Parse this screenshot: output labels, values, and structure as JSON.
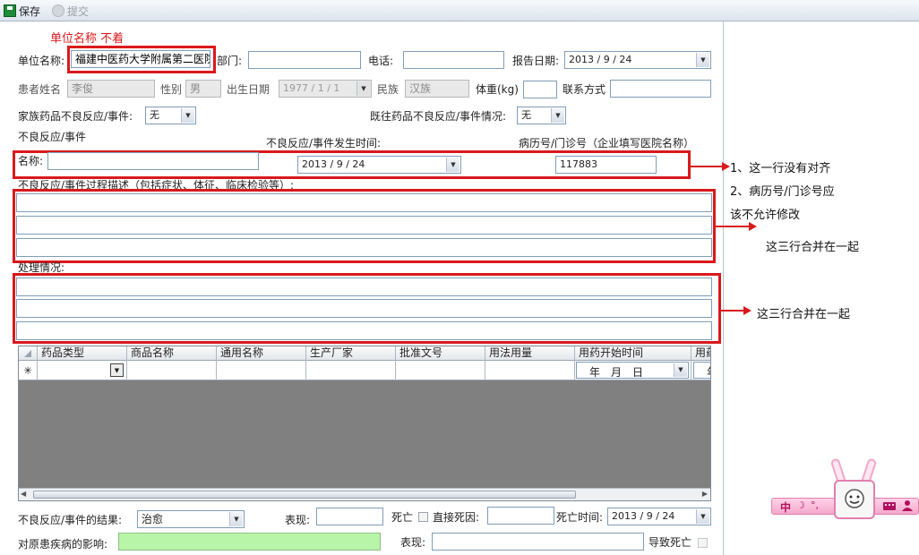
{
  "toolbar": {
    "save_label": "保存",
    "submit_label": "提交"
  },
  "annotation_top": "单位名称 不着",
  "row1": {
    "unit_label": "单位名称:",
    "unit_value": "福建中医药大学附属第二医院",
    "dept_label": "部门:",
    "dept_value": "",
    "phone_label": "电话:",
    "phone_value": "",
    "report_date_label": "报告日期:",
    "report_date_value": "2013 / 9 / 24"
  },
  "row2": {
    "patient_label": "患者姓名",
    "patient_value": "李俊",
    "gender_label": "性别",
    "gender_value": "男",
    "birth_label": "出生日期",
    "birth_value": "1977 / 1 / 1",
    "ethnic_label": "民族",
    "ethnic_value": "汉族",
    "weight_label": "体重(kg)",
    "weight_value": "",
    "contact_label": "联系方式",
    "contact_value": ""
  },
  "row3": {
    "family_label": "家族药品不良反应/事件:",
    "family_value": "无",
    "history_label": "既往药品不良反应/事件情况:",
    "history_value": "无"
  },
  "adr": {
    "section_label": "不良反应/事件",
    "time_label": "不良反应/事件发生时间:",
    "record_label": "病历号/门诊号（企业填写医院名称）",
    "name_label": "名称:",
    "name_value": "",
    "time_value": "2013 / 9 / 24",
    "record_value": "117883",
    "process_label": "不良反应/事件过程描述（包括症状、体征、临床检验等）:",
    "treatment_label": "处理情况:"
  },
  "notes": {
    "note1": "1、这一行没有对齐",
    "note2": "2、病历号/门诊号应",
    "note3": "该不允许修改",
    "note4": "这三行合并在一起",
    "note5": "这三行合并在一起"
  },
  "grid": {
    "columns": [
      "药品类型",
      "商品名称",
      "通用名称",
      "生产厂家",
      "批准文号",
      "用法用量",
      "用药开始时间",
      "用药"
    ],
    "new_row_marker": "✳",
    "date_placeholder": "年　月　日",
    "date_cut": "年"
  },
  "bottom": {
    "result_label": "不良反应/事件的结果:",
    "result_value": "治愈",
    "symptom_label": "表现:",
    "symptom_value": "",
    "death_label": "死亡",
    "direct_cause_label": "直接死因:",
    "direct_cause_value": "",
    "death_time_label": "死亡时间:",
    "death_time_value": "2013 / 9 / 24",
    "impact_label": "对原患疾病的影响:",
    "impact_value": "",
    "impact_symptom_label": "表现:",
    "impact_symptom_value": "",
    "caused_death_label": "导致死亡"
  },
  "ime": {
    "mode": "中",
    "moon": "☽",
    "punct": "°,"
  },
  "colors": {
    "annotation_red": "#d9191c",
    "impact_field_bg": "#b8f5a8"
  }
}
